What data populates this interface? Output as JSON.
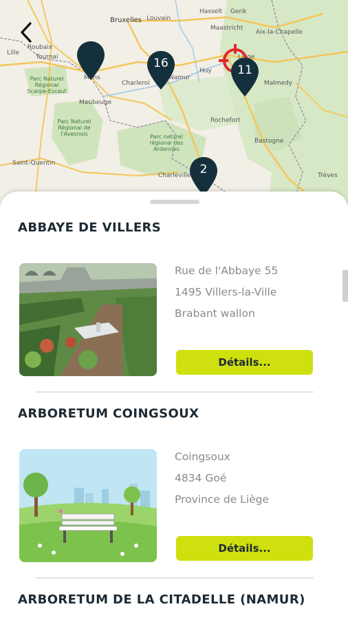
{
  "map": {
    "labels": {
      "bruxelles": "Bruxelles",
      "louvain": "Louvain",
      "hasselt": "Hasselt",
      "genk": "Genk",
      "maastricht": "Maastricht",
      "aix": "Aix-la-Chapelle",
      "lille": "Lille",
      "roubaix": "Roubaix",
      "tournai": "Tournai",
      "mons": "Mons",
      "namur": "Namur",
      "charleroi": "Charleroi",
      "huy": "Huy",
      "liege": "Liège",
      "maubeuge": "Maubeuge",
      "malmedy": "Malmedy",
      "rochefort": "Rochefort",
      "bastogne": "Bastogne",
      "saintquentin": "Saint-Quentin",
      "charleville": "Charleville",
      "treves": "Trèves",
      "park_scarpe": "Parc Naturel Régional Scarpe-Escaut",
      "park_avesnois": "Parc Naturel Régional de l'Avesnois",
      "park_ardennes": "Parc naturel régional des Ardennes"
    },
    "clusters": [
      {
        "count": ""
      },
      {
        "count": "16"
      },
      {
        "count": "11"
      },
      {
        "count": "2"
      }
    ]
  },
  "places": [
    {
      "name": "ABBAYE DE VILLERS",
      "address": [
        "Rue de l'Abbaye 55",
        "1495 Villers-la-Ville",
        "Brabant wallon"
      ],
      "button": "Détails..."
    },
    {
      "name": "ARBORETUM COINGSOUX",
      "address": [
        "Coingsoux",
        "4834 Goé",
        "Province de Liège"
      ],
      "button": "Détails..."
    },
    {
      "name": "ARBORETUM DE LA CITADELLE (NAMUR)"
    }
  ]
}
